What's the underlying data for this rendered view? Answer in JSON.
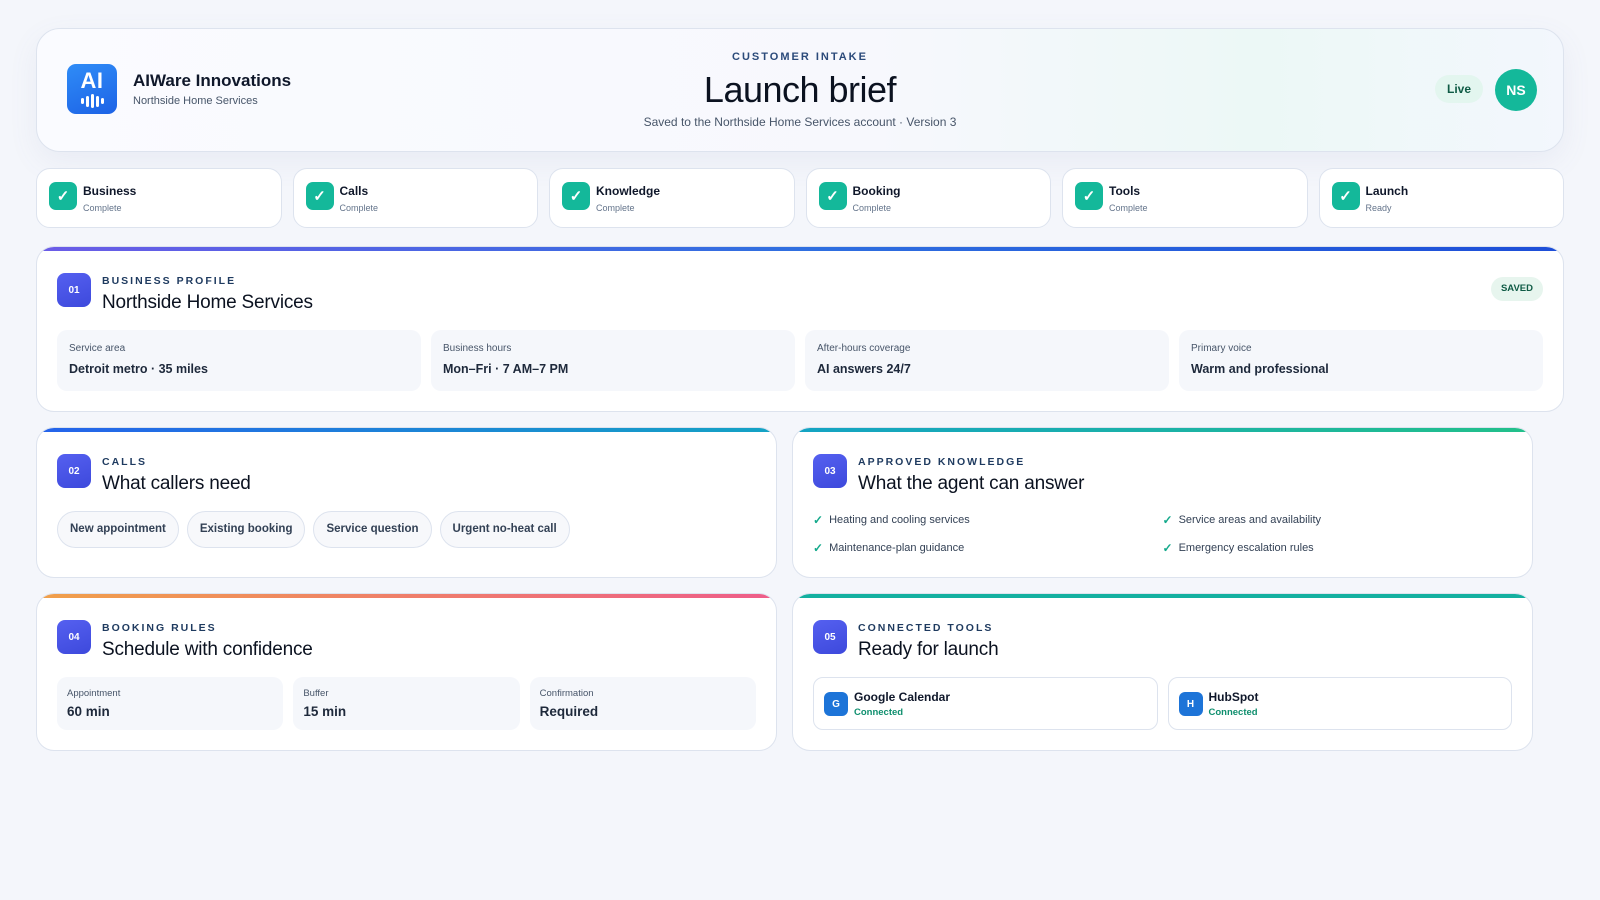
{
  "header": {
    "logo_text": "AI",
    "brand_name": "AIWare Innovations",
    "brand_sub": "Northside Home Services",
    "eyebrow": "CUSTOMER INTAKE",
    "title": "Launch brief",
    "saved_line": "Saved to the Northside Home Services account · Version 3",
    "status_badge": "Live",
    "avatar_initials": "NS"
  },
  "steps": [
    {
      "label": "Business",
      "status": "Complete"
    },
    {
      "label": "Calls",
      "status": "Complete"
    },
    {
      "label": "Knowledge",
      "status": "Complete"
    },
    {
      "label": "Booking",
      "status": "Complete"
    },
    {
      "label": "Tools",
      "status": "Complete"
    },
    {
      "label": "Launch",
      "status": "Ready"
    }
  ],
  "check_glyph": "✓",
  "profile": {
    "number": "01",
    "eyebrow": "BUSINESS PROFILE",
    "title": "Northside Home Services",
    "badge": "SAVED",
    "facts": [
      {
        "label": "Service area",
        "value": "Detroit metro · 35 miles"
      },
      {
        "label": "Business hours",
        "value": "Mon–Fri · 7 AM–7 PM"
      },
      {
        "label": "After-hours coverage",
        "value": "AI answers 24/7"
      },
      {
        "label": "Primary voice",
        "value": "Warm and professional"
      }
    ]
  },
  "calls": {
    "number": "02",
    "eyebrow": "CALLS",
    "title": "What callers need",
    "chips": [
      "New appointment",
      "Existing booking",
      "Service question",
      "Urgent no-heat call"
    ]
  },
  "knowledge": {
    "number": "03",
    "eyebrow": "APPROVED KNOWLEDGE",
    "title": "What the agent can answer",
    "items": [
      "Heating and cooling services",
      "Service areas and availability",
      "Maintenance-plan guidance",
      "Emergency escalation rules"
    ]
  },
  "booking": {
    "number": "04",
    "eyebrow": "BOOKING RULES",
    "title": "Schedule with confidence",
    "rules": [
      {
        "label": "Appointment",
        "value": "60 min"
      },
      {
        "label": "Buffer",
        "value": "15 min"
      },
      {
        "label": "Confirmation",
        "value": "Required"
      }
    ]
  },
  "tools": {
    "number": "05",
    "eyebrow": "CONNECTED TOOLS",
    "title": "Ready for launch",
    "items": [
      {
        "icon_letter": "G",
        "name": "Google Calendar",
        "status": "Connected"
      },
      {
        "icon_letter": "H",
        "name": "HubSpot",
        "status": "Connected"
      }
    ]
  },
  "colors": {
    "accent_teal": "#14b89a",
    "accent_indigo": "#4a55e8",
    "bar_profile": [
      "#6b5ce7",
      "#2f6fe0",
      "#1d4ed8"
    ],
    "bar_calls": [
      "#2563eb",
      "#14a3c4"
    ],
    "bar_knowledge": [
      "#14a3c4",
      "#22c08a"
    ],
    "bar_booking": [
      "#f0a04a",
      "#ee5d8a"
    ],
    "bar_tools": [
      "#14b0a0",
      "#14b0a0"
    ]
  }
}
